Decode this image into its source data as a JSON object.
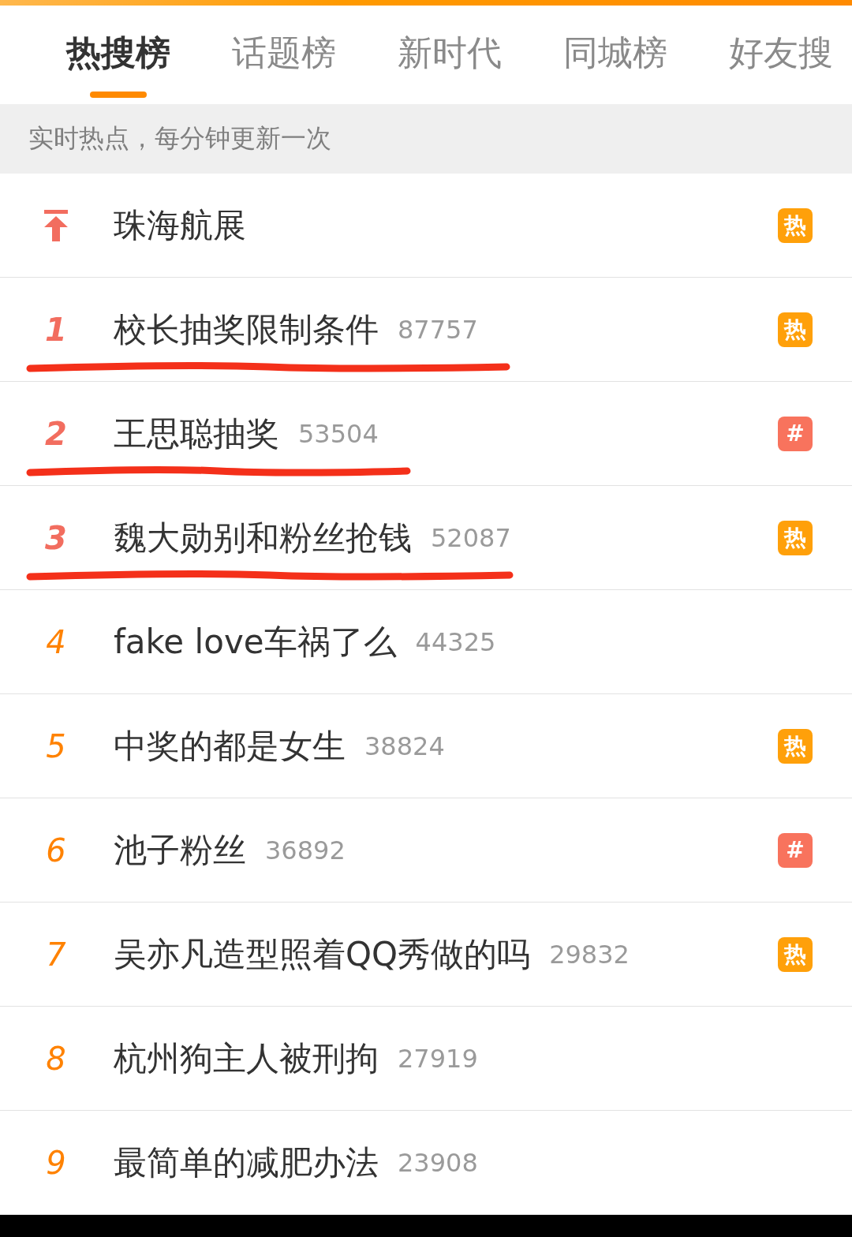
{
  "tabs": [
    {
      "label": "热搜榜",
      "selected": true
    },
    {
      "label": "话题榜",
      "selected": false
    },
    {
      "label": "新时代",
      "selected": false
    },
    {
      "label": "同城榜",
      "selected": false
    },
    {
      "label": "好友搜",
      "selected": false
    }
  ],
  "notice": "实时热点，每分钟更新一次",
  "items": [
    {
      "kind": "pinned",
      "title": "珠海航展",
      "badge": {
        "kind": "hot",
        "text": "热"
      },
      "underlined": false
    },
    {
      "kind": "ranked",
      "rank": "1",
      "title": "校长抽奖限制条件",
      "count": "87757",
      "badge": {
        "kind": "hot",
        "text": "热"
      },
      "underlined": true
    },
    {
      "kind": "ranked",
      "rank": "2",
      "title": "王思聪抽奖",
      "count": "53504",
      "badge": {
        "kind": "topic",
        "text": "#"
      },
      "underlined": true
    },
    {
      "kind": "ranked",
      "rank": "3",
      "title": "魏大勋别和粉丝抢钱",
      "count": "52087",
      "badge": {
        "kind": "hot",
        "text": "热"
      },
      "underlined": true
    },
    {
      "kind": "ranked",
      "rank": "4",
      "title": "fake love车祸了么",
      "count": "44325",
      "underlined": false
    },
    {
      "kind": "ranked",
      "rank": "5",
      "title": "中奖的都是女生",
      "count": "38824",
      "badge": {
        "kind": "hot",
        "text": "热"
      },
      "underlined": false
    },
    {
      "kind": "ranked",
      "rank": "6",
      "title": "池子粉丝",
      "count": "36892",
      "badge": {
        "kind": "topic",
        "text": "#"
      },
      "underlined": false
    },
    {
      "kind": "ranked",
      "rank": "7",
      "title": "吴亦凡造型照着QQ秀做的吗",
      "count": "29832",
      "badge": {
        "kind": "hot",
        "text": "热"
      },
      "underlined": false
    },
    {
      "kind": "ranked",
      "rank": "8",
      "title": "杭州狗主人被刑拘",
      "count": "27919",
      "underlined": false
    },
    {
      "kind": "ranked",
      "rank": "9",
      "title": "最简单的减肥办法",
      "count": "23908",
      "underlined": false
    }
  ]
}
